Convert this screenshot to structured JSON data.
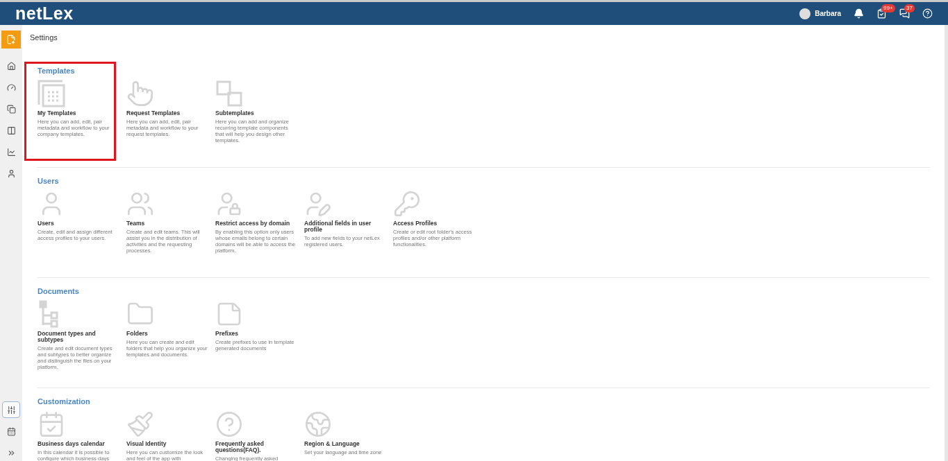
{
  "header": {
    "logo": "netLex",
    "user": "Barbara",
    "badges": [
      {
        "kind": "tasks",
        "count": "99+"
      },
      {
        "kind": "chat",
        "count": "37"
      }
    ]
  },
  "sidebar": {
    "items": [
      {
        "selected": false
      },
      {
        "selected": false
      },
      {
        "selected": false
      },
      {
        "selected": false
      },
      {
        "selected": false
      },
      {
        "selected": false
      }
    ],
    "bottom_items": [
      {
        "selected": true
      },
      {
        "selected": false
      },
      {
        "selected": false
      }
    ]
  },
  "page_title": "Settings",
  "sections": [
    {
      "title": "Templates",
      "highlighted": true,
      "cards": [
        {
          "title": "My Templates",
          "description": "Here you can add, edit, pair metadata and workflow to your company templates."
        },
        {
          "title": "Request Templates",
          "description": "Here you can add, edit, pair metadata and workflow to your request templates."
        },
        {
          "title": "Subtemplates",
          "description": "Here you can add and organize recurring template components that will help you design other templates."
        }
      ]
    },
    {
      "title": "Users",
      "highlighted": false,
      "cards": [
        {
          "title": "Users",
          "description": "Create, edit and assign different access profiles to your users."
        },
        {
          "title": "Teams",
          "description": "Create and edit teams. This will assist you in the distribution of activities and the requesting processes."
        },
        {
          "title": "Restrict access by domain",
          "description": "By enabling this option only users whose emails belong to certain domains will be able to access the platform."
        },
        {
          "title": "Additional fields in user profile",
          "description": "To add new fields to your netLex registered users."
        },
        {
          "title": "Access Profiles",
          "description": "Create or edit root folder's access profiles and/or other platform functionalities."
        }
      ]
    },
    {
      "title": "Documents",
      "highlighted": false,
      "cards": [
        {
          "title": "Document types and subtypes",
          "description": "Create and edit document types and subtypes to better organize and distinguish the files on your platform."
        },
        {
          "title": "Folders",
          "description": "Here you can create and edit folders that help you organize your templates and documents."
        },
        {
          "title": "Prefixes",
          "description": "Create prefixes to use in template generated documents"
        }
      ]
    },
    {
      "title": "Customization",
      "highlighted": false,
      "cards": [
        {
          "title": "Business days calendar",
          "description": "In this calendar it is possible to configure which business days"
        },
        {
          "title": "Visual Identity",
          "description": "Here you can customize the look and feel of the app with"
        },
        {
          "title": "Frequently asked questions(FAQ).",
          "description": "Changing frequently asked"
        },
        {
          "title": "Region & Language",
          "description": "Set your language and time zone"
        }
      ]
    }
  ]
}
